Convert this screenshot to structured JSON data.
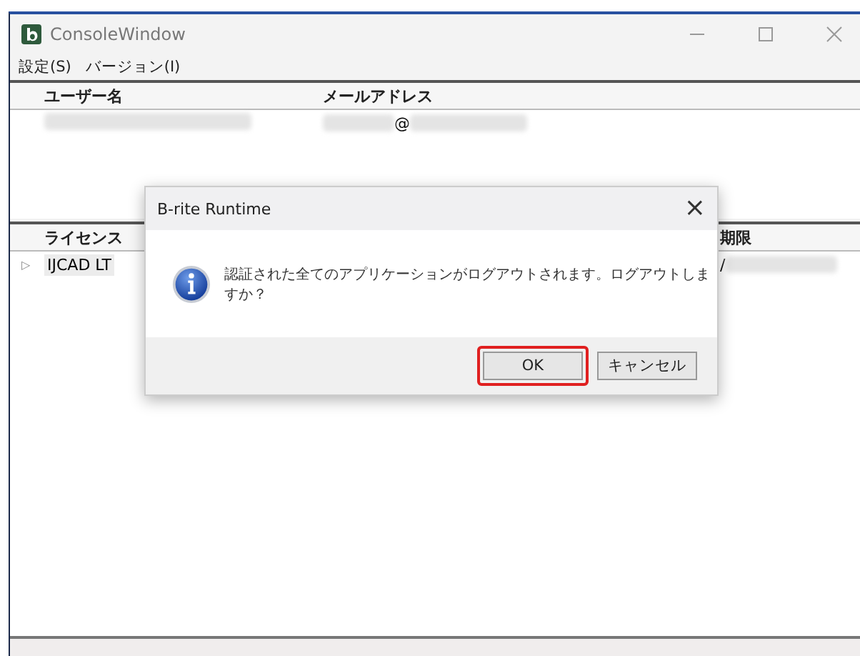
{
  "window": {
    "title": "ConsoleWindow"
  },
  "menu": [
    {
      "label": "設定(S)"
    },
    {
      "label": "バージョン(I)"
    }
  ],
  "users_table": {
    "columns": [
      "ユーザー名",
      "メールアドレス"
    ],
    "rows": [
      {
        "user_name": {
          "kind": "blurred"
        },
        "email": {
          "kind": "blurred",
          "separator": "@"
        }
      }
    ]
  },
  "license_table": {
    "columns": [
      "ライセンス",
      "期限"
    ],
    "rows": [
      {
        "expand": "▷",
        "expanded": false,
        "license": "IJCAD LT",
        "expiry": {
          "kind": "blurred",
          "separator": "/"
        }
      }
    ]
  },
  "dialog": {
    "title": "B-rite Runtime",
    "close": "×",
    "message": "認証された全てのアプリケーションがログアウトされます。ログアウトしますか？",
    "buttons": [
      {
        "label": "OK",
        "highlighted": true
      },
      {
        "label": "キャンセル",
        "highlighted": false
      }
    ]
  }
}
